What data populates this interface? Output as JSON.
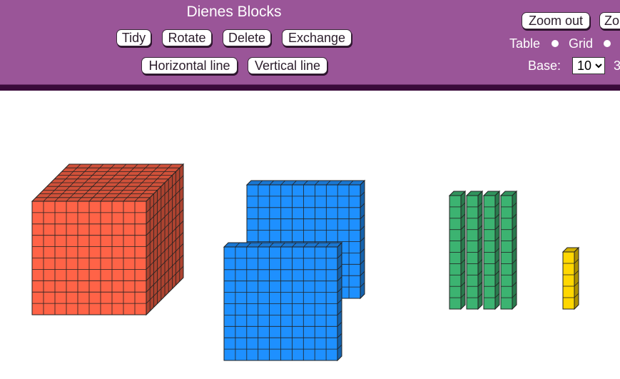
{
  "header": {
    "title": "Dienes Blocks",
    "buttons": {
      "tidy": "Tidy",
      "rotate": "Rotate",
      "delete": "Delete",
      "exchange": "Exchange",
      "horizontal_line": "Horizontal line",
      "vertical_line": "Vertical line",
      "zoom_out": "Zoom out",
      "zoom_in_partial": "Zo"
    },
    "labels": {
      "table": "Table",
      "grid": "Grid",
      "base": "Base:",
      "clipped_text": "3"
    },
    "base_select": {
      "selected": "10"
    }
  },
  "blocks": {
    "cubes": 1,
    "flats": 2,
    "longs": 4,
    "units": 4
  },
  "colors": {
    "header_bg": "#9a5598",
    "header_border": "#3a0b3a",
    "cube": "#ff6347",
    "flat": "#1e90ff",
    "long": "#3cb371",
    "unit": "#ffd700"
  }
}
